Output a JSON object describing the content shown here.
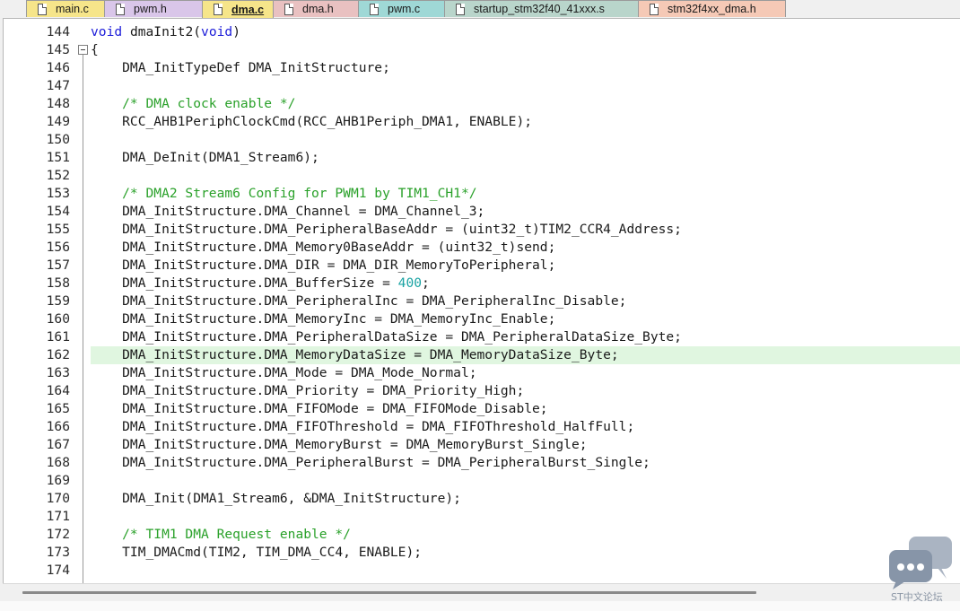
{
  "tabs": [
    {
      "label": "main.c",
      "color": "#f6e58a",
      "active": false
    },
    {
      "label": "pwm.h",
      "color": "#d9c6e9",
      "active": false
    },
    {
      "label": "dma.c",
      "color": "#f6e58a",
      "active": true
    },
    {
      "label": "dma.h",
      "color": "#e9c1c1",
      "active": false
    },
    {
      "label": "pwm.c",
      "color": "#9fd8d6",
      "active": false
    },
    {
      "label": "startup_stm32f40_41xxx.s",
      "color": "#b9d5cb",
      "active": false
    },
    {
      "label": "stm32f4xx_dma.h",
      "color": "#f5c9b6",
      "active": false
    }
  ],
  "editor": {
    "highlight_line": "162",
    "lines": [
      {
        "n": "144",
        "text": "void dmaInit2(void)"
      },
      {
        "n": "145",
        "text": "{"
      },
      {
        "n": "146",
        "text": "    DMA_InitTypeDef DMA_InitStructure;"
      },
      {
        "n": "147",
        "text": ""
      },
      {
        "n": "148",
        "text": "    /* DMA clock enable */"
      },
      {
        "n": "149",
        "text": "    RCC_AHB1PeriphClockCmd(RCC_AHB1Periph_DMA1, ENABLE);"
      },
      {
        "n": "150",
        "text": ""
      },
      {
        "n": "151",
        "text": "    DMA_DeInit(DMA1_Stream6);"
      },
      {
        "n": "152",
        "text": ""
      },
      {
        "n": "153",
        "text": "    /* DMA2 Stream6 Config for PWM1 by TIM1_CH1*/"
      },
      {
        "n": "154",
        "text": "    DMA_InitStructure.DMA_Channel = DMA_Channel_3;"
      },
      {
        "n": "155",
        "text": "    DMA_InitStructure.DMA_PeripheralBaseAddr = (uint32_t)TIM2_CCR4_Address;"
      },
      {
        "n": "156",
        "text": "    DMA_InitStructure.DMA_Memory0BaseAddr = (uint32_t)send;"
      },
      {
        "n": "157",
        "text": "    DMA_InitStructure.DMA_DIR = DMA_DIR_MemoryToPeripheral;"
      },
      {
        "n": "158",
        "text": "    DMA_InitStructure.DMA_BufferSize = 400;"
      },
      {
        "n": "159",
        "text": "    DMA_InitStructure.DMA_PeripheralInc = DMA_PeripheralInc_Disable;"
      },
      {
        "n": "160",
        "text": "    DMA_InitStructure.DMA_MemoryInc = DMA_MemoryInc_Enable;"
      },
      {
        "n": "161",
        "text": "    DMA_InitStructure.DMA_PeripheralDataSize = DMA_PeripheralDataSize_Byte;"
      },
      {
        "n": "162",
        "text": "    DMA_InitStructure.DMA_MemoryDataSize = DMA_MemoryDataSize_Byte;"
      },
      {
        "n": "163",
        "text": "    DMA_InitStructure.DMA_Mode = DMA_Mode_Normal;"
      },
      {
        "n": "164",
        "text": "    DMA_InitStructure.DMA_Priority = DMA_Priority_High;"
      },
      {
        "n": "165",
        "text": "    DMA_InitStructure.DMA_FIFOMode = DMA_FIFOMode_Disable;"
      },
      {
        "n": "166",
        "text": "    DMA_InitStructure.DMA_FIFOThreshold = DMA_FIFOThreshold_HalfFull;"
      },
      {
        "n": "167",
        "text": "    DMA_InitStructure.DMA_MemoryBurst = DMA_MemoryBurst_Single;"
      },
      {
        "n": "168",
        "text": "    DMA_InitStructure.DMA_PeripheralBurst = DMA_PeripheralBurst_Single;"
      },
      {
        "n": "169",
        "text": ""
      },
      {
        "n": "170",
        "text": "    DMA_Init(DMA1_Stream6, &DMA_InitStructure);"
      },
      {
        "n": "171",
        "text": ""
      },
      {
        "n": "172",
        "text": "    /* TIM1 DMA Request enable */"
      },
      {
        "n": "173",
        "text": "    TIM_DMACmd(TIM2, TIM_DMA_CC4, ENABLE);"
      },
      {
        "n": "174",
        "text": ""
      }
    ]
  },
  "colors": {
    "keyword": "#1c1cd9",
    "comment": "#2aa12a",
    "number": "#1aa3a3",
    "current_line": "#e0f6e0"
  },
  "watermark": {
    "text": "ST中文论坛",
    "icon": "chat-bubbles-icon"
  }
}
